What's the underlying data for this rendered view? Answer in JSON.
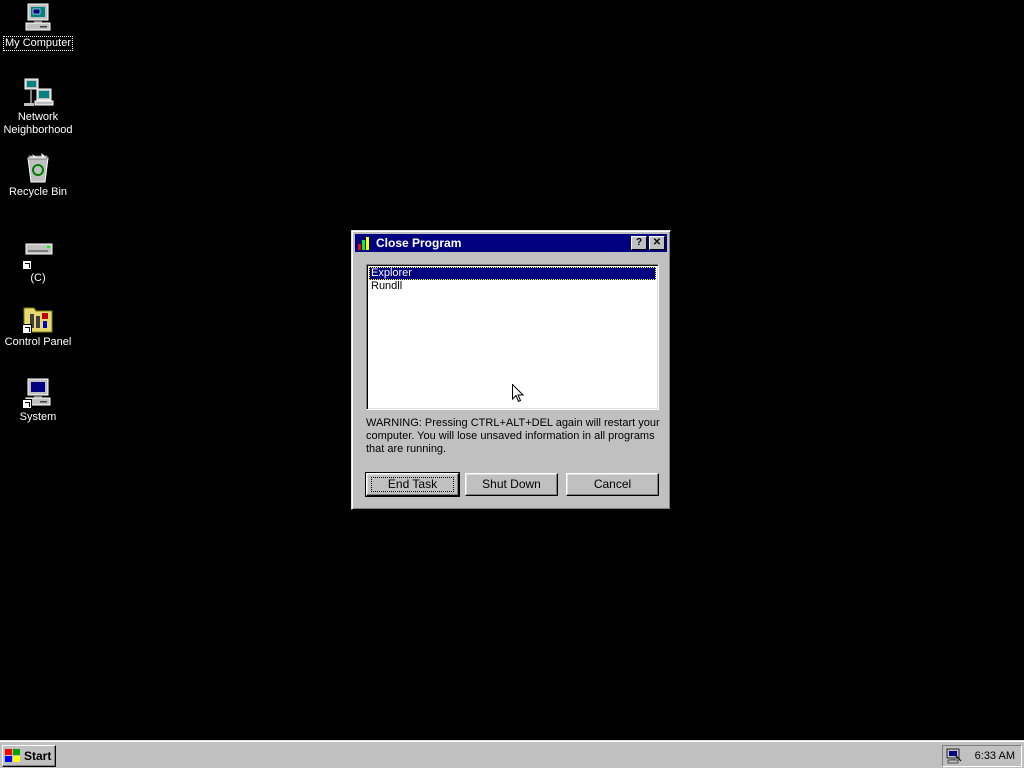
{
  "desktop": {
    "icons": [
      {
        "label": "My Computer",
        "icon": "my-computer-icon"
      },
      {
        "label": "Network Neighborhood",
        "icon": "network-neighborhood-icon"
      },
      {
        "label": "Recycle Bin",
        "icon": "recycle-bin-icon"
      },
      {
        "label": "(C)",
        "icon": "drive-c-icon"
      },
      {
        "label": "Control Panel",
        "icon": "control-panel-icon"
      },
      {
        "label": "System",
        "icon": "system-icon"
      }
    ]
  },
  "dialog": {
    "title": "Close Program",
    "title_icon": "close-program-icon",
    "help_button": "?",
    "close_button": "✕",
    "programs": [
      "Explorer",
      "Rundll"
    ],
    "selected_program": "Explorer",
    "warning": "WARNING: Pressing CTRL+ALT+DEL again will restart your computer. You will lose unsaved information in all programs that are running.",
    "buttons": {
      "end_task": "End Task",
      "shut_down": "Shut Down",
      "cancel": "Cancel"
    }
  },
  "taskbar": {
    "start_label": "Start",
    "clock": "6:33 AM",
    "tray_icon": "display-settings-tray-icon"
  },
  "colors": {
    "desktop_bg": "#000000",
    "titlebar": "#000080",
    "face": "#c0c0c0",
    "selection": "#000080"
  }
}
